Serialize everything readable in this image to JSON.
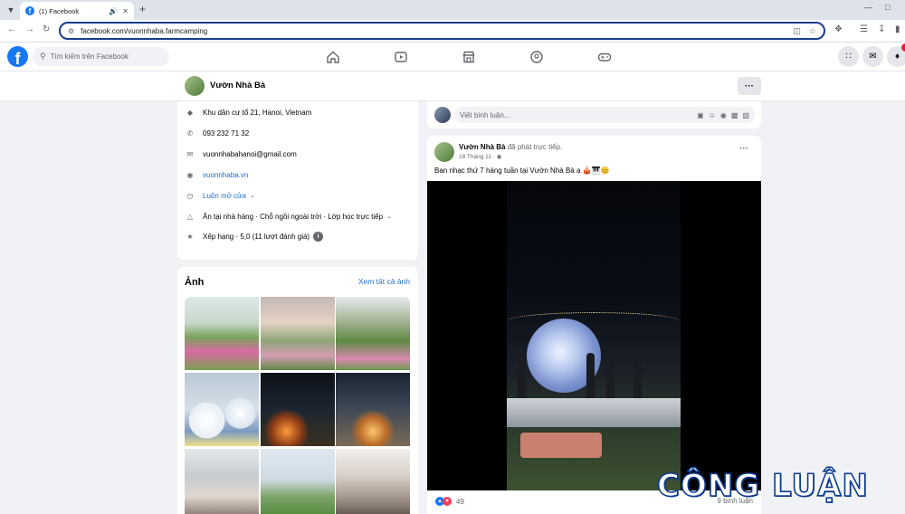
{
  "browser": {
    "tab_title": "(1) Facebook",
    "url": "facebook.com/vuonnhaba.farmcamping"
  },
  "fb": {
    "search_placeholder": "Tìm kiếm trên Facebook"
  },
  "page": {
    "name": "Vườn Nhà Bà"
  },
  "intro": {
    "address": "Khu dân cư tổ 21, Hanoi, Vietnam",
    "phone": "093 232 71 32",
    "email": "vuonnhabahanoi@gmail.com",
    "website": "vuonnhaba.vn",
    "hours": "Luôn mở cửa",
    "services": "Ăn tại nhà hàng · Chỗ ngồi ngoài trời · Lớp học trực tiếp",
    "rating": "Xếp hạng · 5,0 (11 lượt đánh giá)"
  },
  "photos": {
    "title": "Ảnh",
    "see_all": "Xem tất cả ảnh"
  },
  "comment_box": {
    "placeholder": "Viết bình luận..."
  },
  "post": {
    "author": "Vườn Nhà Bà",
    "action": "đã phát trực tiếp.",
    "date": "18 Tháng 11 ·",
    "text": "Ban nhạc thứ 7 hàng tuần tại Vườn Nhà Bà ạ 🎪🎹😊",
    "reaction_count": "49",
    "comment_count": "9 bình luận"
  },
  "watermark": {
    "text": "CÔNG LUẬN"
  },
  "colors": {
    "fb_blue": "#1877f2",
    "link_blue": "#216fdb",
    "watermark_blue": "#0d3b8c"
  }
}
